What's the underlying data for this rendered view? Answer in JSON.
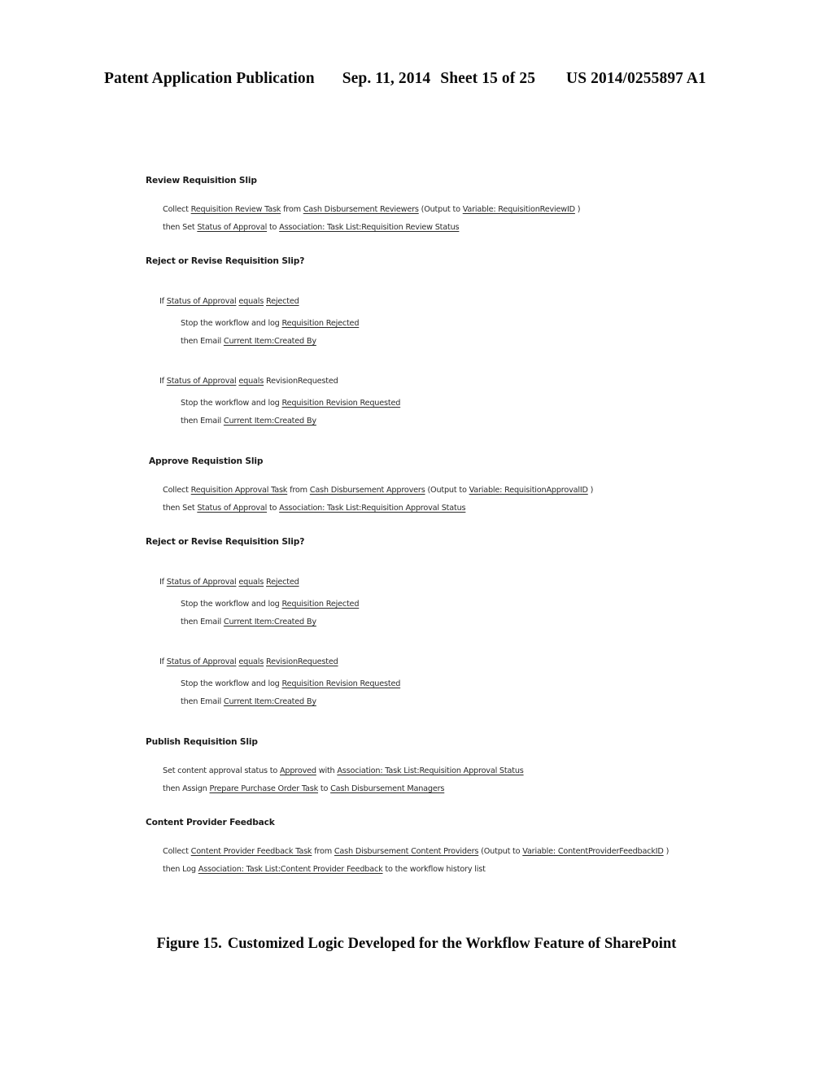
{
  "header": {
    "publication": "Patent Application Publication",
    "date": "Sep. 11, 2014",
    "sheet": "Sheet 15 of 25",
    "number": "US 2014/0255897 A1"
  },
  "caption": {
    "label": "Figure 15.",
    "text": "Customized Logic Developed for the Workflow Feature of SharePoint"
  },
  "workflow": {
    "s1": {
      "heading": "Review Requisition Slip",
      "l1": {
        "t1": "Collect ",
        "u1": "Requisition Review Task",
        "t2": " from ",
        "u2": "Cash Disbursement Reviewers",
        "t3": " (Output to ",
        "u3": "Variable: RequisitionReviewID",
        "t4": " )"
      },
      "l2": {
        "t1": "then Set ",
        "u1": "Status of Approval",
        "t2": " to ",
        "u2": "Association: Task List:Requisition Review Status"
      }
    },
    "s2": {
      "heading": "Reject or Revise Requisition Slip?",
      "b1": {
        "cond": {
          "t1": "If ",
          "u1": "Status of Approval",
          "t2": " ",
          "u2": "equals",
          "t3": " ",
          "u3": "Rejected"
        },
        "a1": {
          "t1": "Stop the workflow and log ",
          "u1": "Requisition Rejected"
        },
        "a2": {
          "t1": "then Email ",
          "u1": "Current Item:Created By"
        }
      },
      "b2": {
        "cond": {
          "t1": "If ",
          "u1": "Status of Approval",
          "t2": " ",
          "u2": "equals",
          "t3": " ",
          "u3": "RevisionRequested"
        },
        "a1": {
          "t1": "Stop the workflow and log ",
          "u1": "Requisition Revision Requested"
        },
        "a2": {
          "t1": "then Email ",
          "u1": "Current Item:Created By"
        }
      }
    },
    "s3": {
      "heading": "Approve Requistion Slip",
      "l1": {
        "t1": "Collect ",
        "u1": "Requisition Approval Task",
        "t2": " from ",
        "u2": "Cash Disbursement Approvers",
        "t3": " (Output to ",
        "u3": "Variable: RequisitionApprovalID",
        "t4": " )"
      },
      "l2": {
        "t1": "then Set ",
        "u1": "Status of Approval",
        "t2": " to ",
        "u2": "Association: Task List:Requisition Approval Status"
      }
    },
    "s4": {
      "heading": "Reject or Revise Requisition Slip?",
      "b1": {
        "cond": {
          "t1": "If ",
          "u1": "Status of Approval",
          "t2": " ",
          "u2": "equals",
          "t3": " ",
          "u3": "Rejected"
        },
        "a1": {
          "t1": "Stop the workflow and log ",
          "u1": "Requisition Rejected"
        },
        "a2": {
          "t1": "then Email ",
          "u1": "Current Item:Created By"
        }
      },
      "b2": {
        "cond": {
          "t1": "If ",
          "u1": "Status of Approval",
          "t2": " ",
          "u2": "equals",
          "t3": " ",
          "u3": "RevisionRequested"
        },
        "a1": {
          "t1": "Stop the workflow and log ",
          "u1": "Requisition Revision Requested"
        },
        "a2": {
          "t1": "then Email ",
          "u1": "Current Item:Created By"
        }
      }
    },
    "s5": {
      "heading": "Publish Requisition Slip",
      "l1": {
        "t1": "Set content approval status to ",
        "u1": "Approved",
        "t2": " with ",
        "u2": "Association: Task List:Requisition Approval Status"
      },
      "l2": {
        "t1": "then Assign ",
        "u1": "Prepare Purchase Order Task",
        "t2": " to ",
        "u2": "Cash Disbursement Managers"
      }
    },
    "s6": {
      "heading": "Content Provider Feedback",
      "l1": {
        "t1": "Collect ",
        "u1": "Content Provider Feedback Task",
        "t2": " from ",
        "u2": "Cash Disbursement Content Providers",
        "t3": " (Output to ",
        "u3": "Variable: ContentProviderFeedbackID",
        "t4": " )"
      },
      "l2": {
        "t1": "then Log ",
        "u1": "Association: Task List:Content Provider Feedback",
        "t2": " to the workflow history list"
      }
    }
  }
}
